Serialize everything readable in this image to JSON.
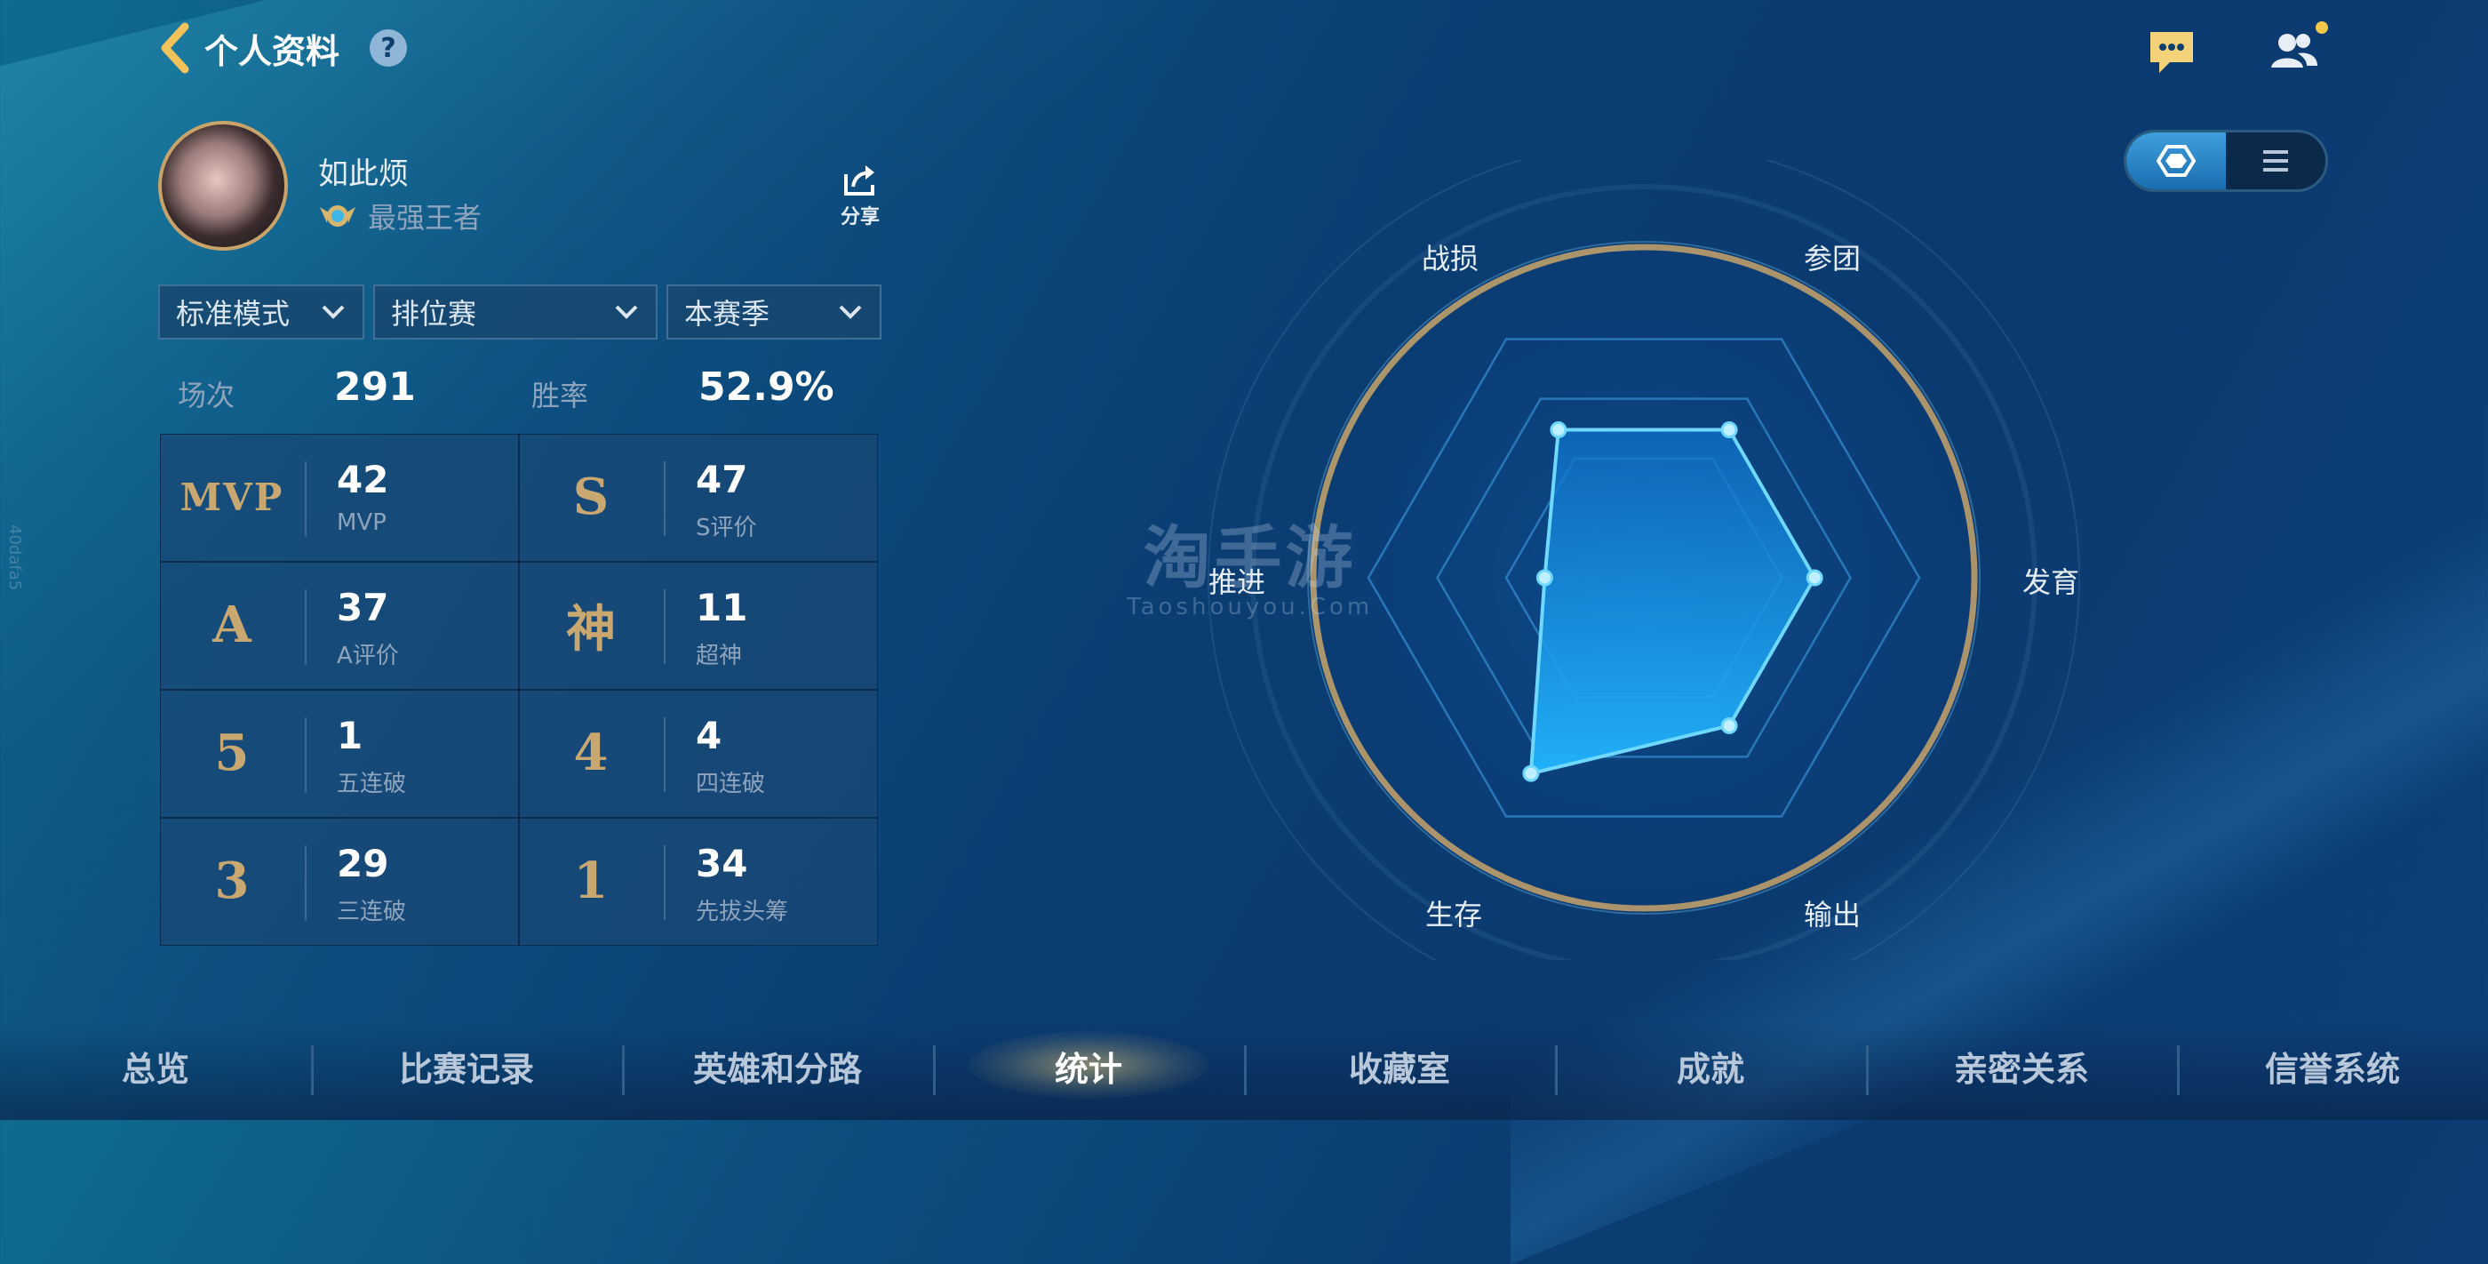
{
  "header": {
    "title": "个人资料",
    "help": "?"
  },
  "profile": {
    "name": "如此烦",
    "rank": "最强王者",
    "share_label": "分享"
  },
  "filters": [
    {
      "label": "标准模式"
    },
    {
      "label": "排位赛"
    },
    {
      "label": "本赛季"
    }
  ],
  "summary": {
    "matches_label": "场次",
    "matches_value": "291",
    "winrate_label": "胜率",
    "winrate_value": "52.9%"
  },
  "stats": [
    {
      "badge": "MVP",
      "value": "42",
      "label": "MVP"
    },
    {
      "badge": "S",
      "value": "47",
      "label": "S评价"
    },
    {
      "badge": "A",
      "value": "37",
      "label": "A评价"
    },
    {
      "badge": "神",
      "value": "11",
      "label": "超神"
    },
    {
      "badge": "5",
      "value": "1",
      "label": "五连破"
    },
    {
      "badge": "4",
      "value": "4",
      "label": "四连破"
    },
    {
      "badge": "3",
      "value": "29",
      "label": "三连破"
    },
    {
      "badge": "1",
      "value": "34",
      "label": "先拔头筹"
    }
  ],
  "radar": {
    "axes": [
      "战损",
      "参团",
      "发育",
      "输出",
      "生存",
      "推进"
    ],
    "values": [
      0.62,
      0.62,
      0.62,
      0.62,
      0.82,
      0.36
    ],
    "colors": {
      "fill": "#1aa3f0",
      "stroke": "#6ed8ff",
      "ring": "#c8a46a"
    }
  },
  "watermark": {
    "big": "淘手游",
    "small": "Taoshouyou.Com"
  },
  "side_id": "40dafa5",
  "nav": {
    "items": [
      "总览",
      "比赛记录",
      "英雄和分路",
      "统计",
      "收藏室",
      "成就",
      "亲密关系",
      "信誉系统"
    ],
    "active_index": 3
  },
  "icons": {
    "back": "back-chevron-icon",
    "help": "help-icon",
    "chat": "chat-icon",
    "friends": "friends-icon",
    "share": "share-icon",
    "rank": "rank-emblem-icon",
    "radar_view": "hexagon-view-icon",
    "list_view": "list-view-icon"
  }
}
